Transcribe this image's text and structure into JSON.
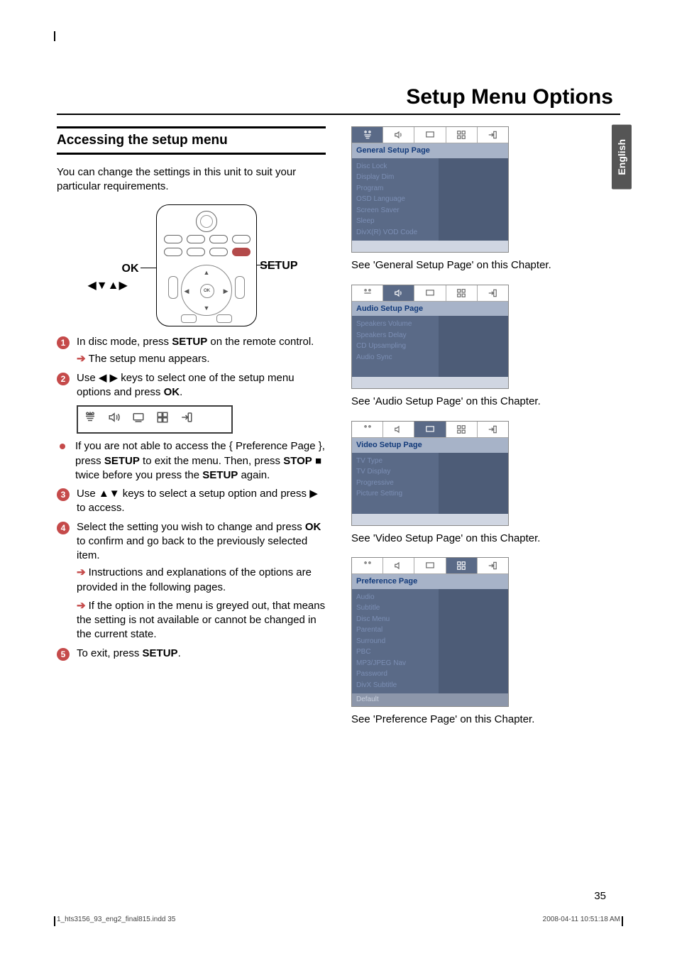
{
  "page": {
    "title": "Setup Menu Options",
    "number": "35",
    "lang_tab": "English",
    "footer_left": "1_hts3156_93_eng2_final815.indd   35",
    "footer_right": "2008-04-11   10:51:18 AM"
  },
  "left": {
    "section_heading": "Accessing the setup menu",
    "intro": "You can change the settings in this unit to suit your particular requirements.",
    "diagram": {
      "ok": "OK",
      "arrows": "◀▼▲▶",
      "setup": "SETUP"
    },
    "steps": {
      "s1_pre": "In disc mode, press ",
      "s1_b": "SETUP",
      "s1_post": " on the remote control.",
      "s1_sub": "The setup menu appears.",
      "s2_pre": "Use ◀ ▶ keys to select one of the setup menu options and press ",
      "s2_b": "OK",
      "s2_post": ".",
      "bullet_pre": "If you are not able to access the { Preference Page }, press ",
      "bullet_b1": "SETUP",
      "bullet_mid1": " to exit the menu. Then, press ",
      "bullet_b2": "STOP",
      "bullet_stopicon": " ■ ",
      "bullet_mid2": "twice before you press the ",
      "bullet_b3": "SETUP",
      "bullet_post": " again.",
      "s3": "Use ▲▼ keys to select a setup option and press ▶ to access.",
      "s4_pre": "Select the setting you wish to change and press ",
      "s4_b": "OK",
      "s4_post": " to confirm and go back to the previously selected item.",
      "s4_sub1": "Instructions and explanations of the options are provided in the following pages.",
      "s4_sub2": "If the option in the menu is greyed out, that means the setting is not available or cannot be changed in the current state.",
      "s5_pre": "To exit, press ",
      "s5_b": "SETUP",
      "s5_post": "."
    }
  },
  "right": {
    "general": {
      "header": "General Setup Page",
      "items": [
        "Disc Lock",
        "Display Dim",
        "Program",
        "OSD Language",
        "Screen Saver",
        "Sleep",
        "DivX(R) VOD Code"
      ],
      "caption": "See 'General Setup Page' on this Chapter."
    },
    "audio": {
      "header": "Audio Setup Page",
      "items": [
        "Speakers Volume",
        "Speakers Delay",
        "CD Upsampling",
        "Audio Sync"
      ],
      "caption": "See 'Audio Setup Page' on this Chapter."
    },
    "video": {
      "header": "Video Setup Page",
      "items": [
        "TV Type",
        "TV Display",
        "Progressive",
        "Picture Setting"
      ],
      "caption": "See 'Video Setup Page' on this Chapter."
    },
    "pref": {
      "header": "Preference Page",
      "items": [
        "Audio",
        "Subtitle",
        "Disc Menu",
        "Parental",
        "Surround",
        "PBC",
        "MP3/JPEG Nav",
        "Password",
        "DivX Subtitle"
      ],
      "footer_item": "Default",
      "caption": "See 'Preference Page' on this Chapter."
    }
  },
  "icons": {
    "t1": "♬",
    "t2": "🔊",
    "t3": "▭",
    "t4": "⊞",
    "t5": "➲"
  }
}
